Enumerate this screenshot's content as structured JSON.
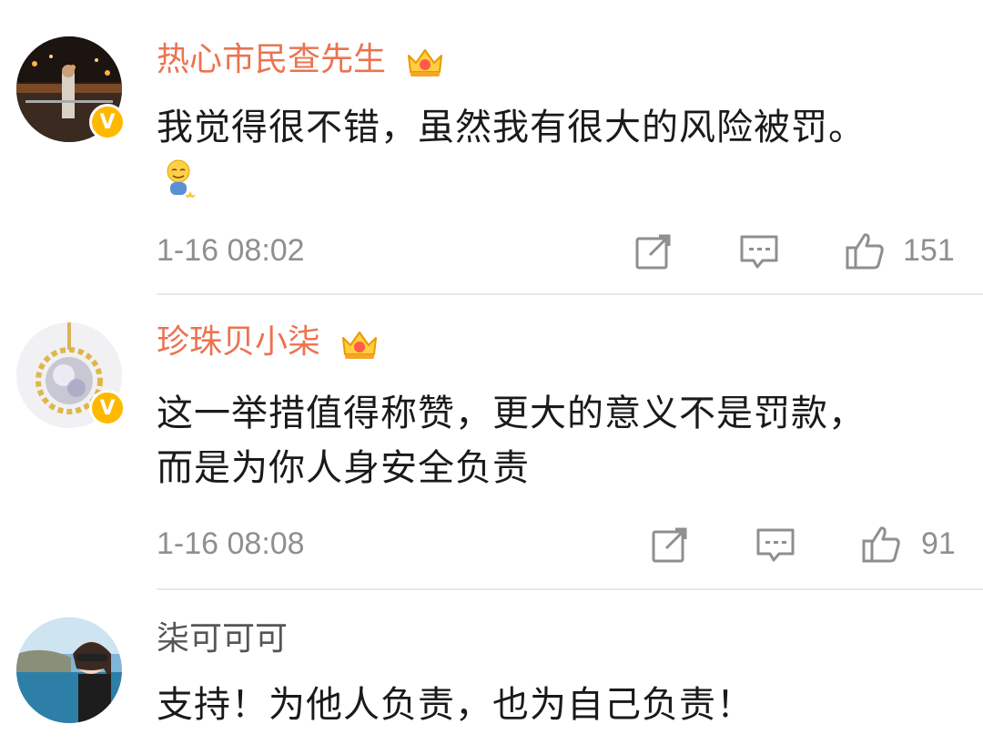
{
  "comments": [
    {
      "username": "热心市民查先生",
      "text_lines": [
        "我觉得很不错，虽然我有很大的风险被罚。"
      ],
      "time": "1-16 08:02",
      "likes": "151",
      "verified": true,
      "vip_crown": true,
      "emoji": "smiling-face-emoji"
    },
    {
      "username": "珍珠贝小柒",
      "text_lines": [
        "这一举措值得称赞，更大的意义不是罚款，",
        "而是为你人身安全负责"
      ],
      "time": "1-16 08:08",
      "likes": "91",
      "verified": true,
      "vip_crown": true
    },
    {
      "username": "柒可可可",
      "text_lines": [
        "支持！为他人负责，也为自己负责！"
      ],
      "verified": false,
      "vip_crown": false
    }
  ],
  "colors": {
    "vip_name": "#eb7350",
    "plain_name": "#555555",
    "meta": "#8f8f8f",
    "badge": "#ffb800"
  }
}
